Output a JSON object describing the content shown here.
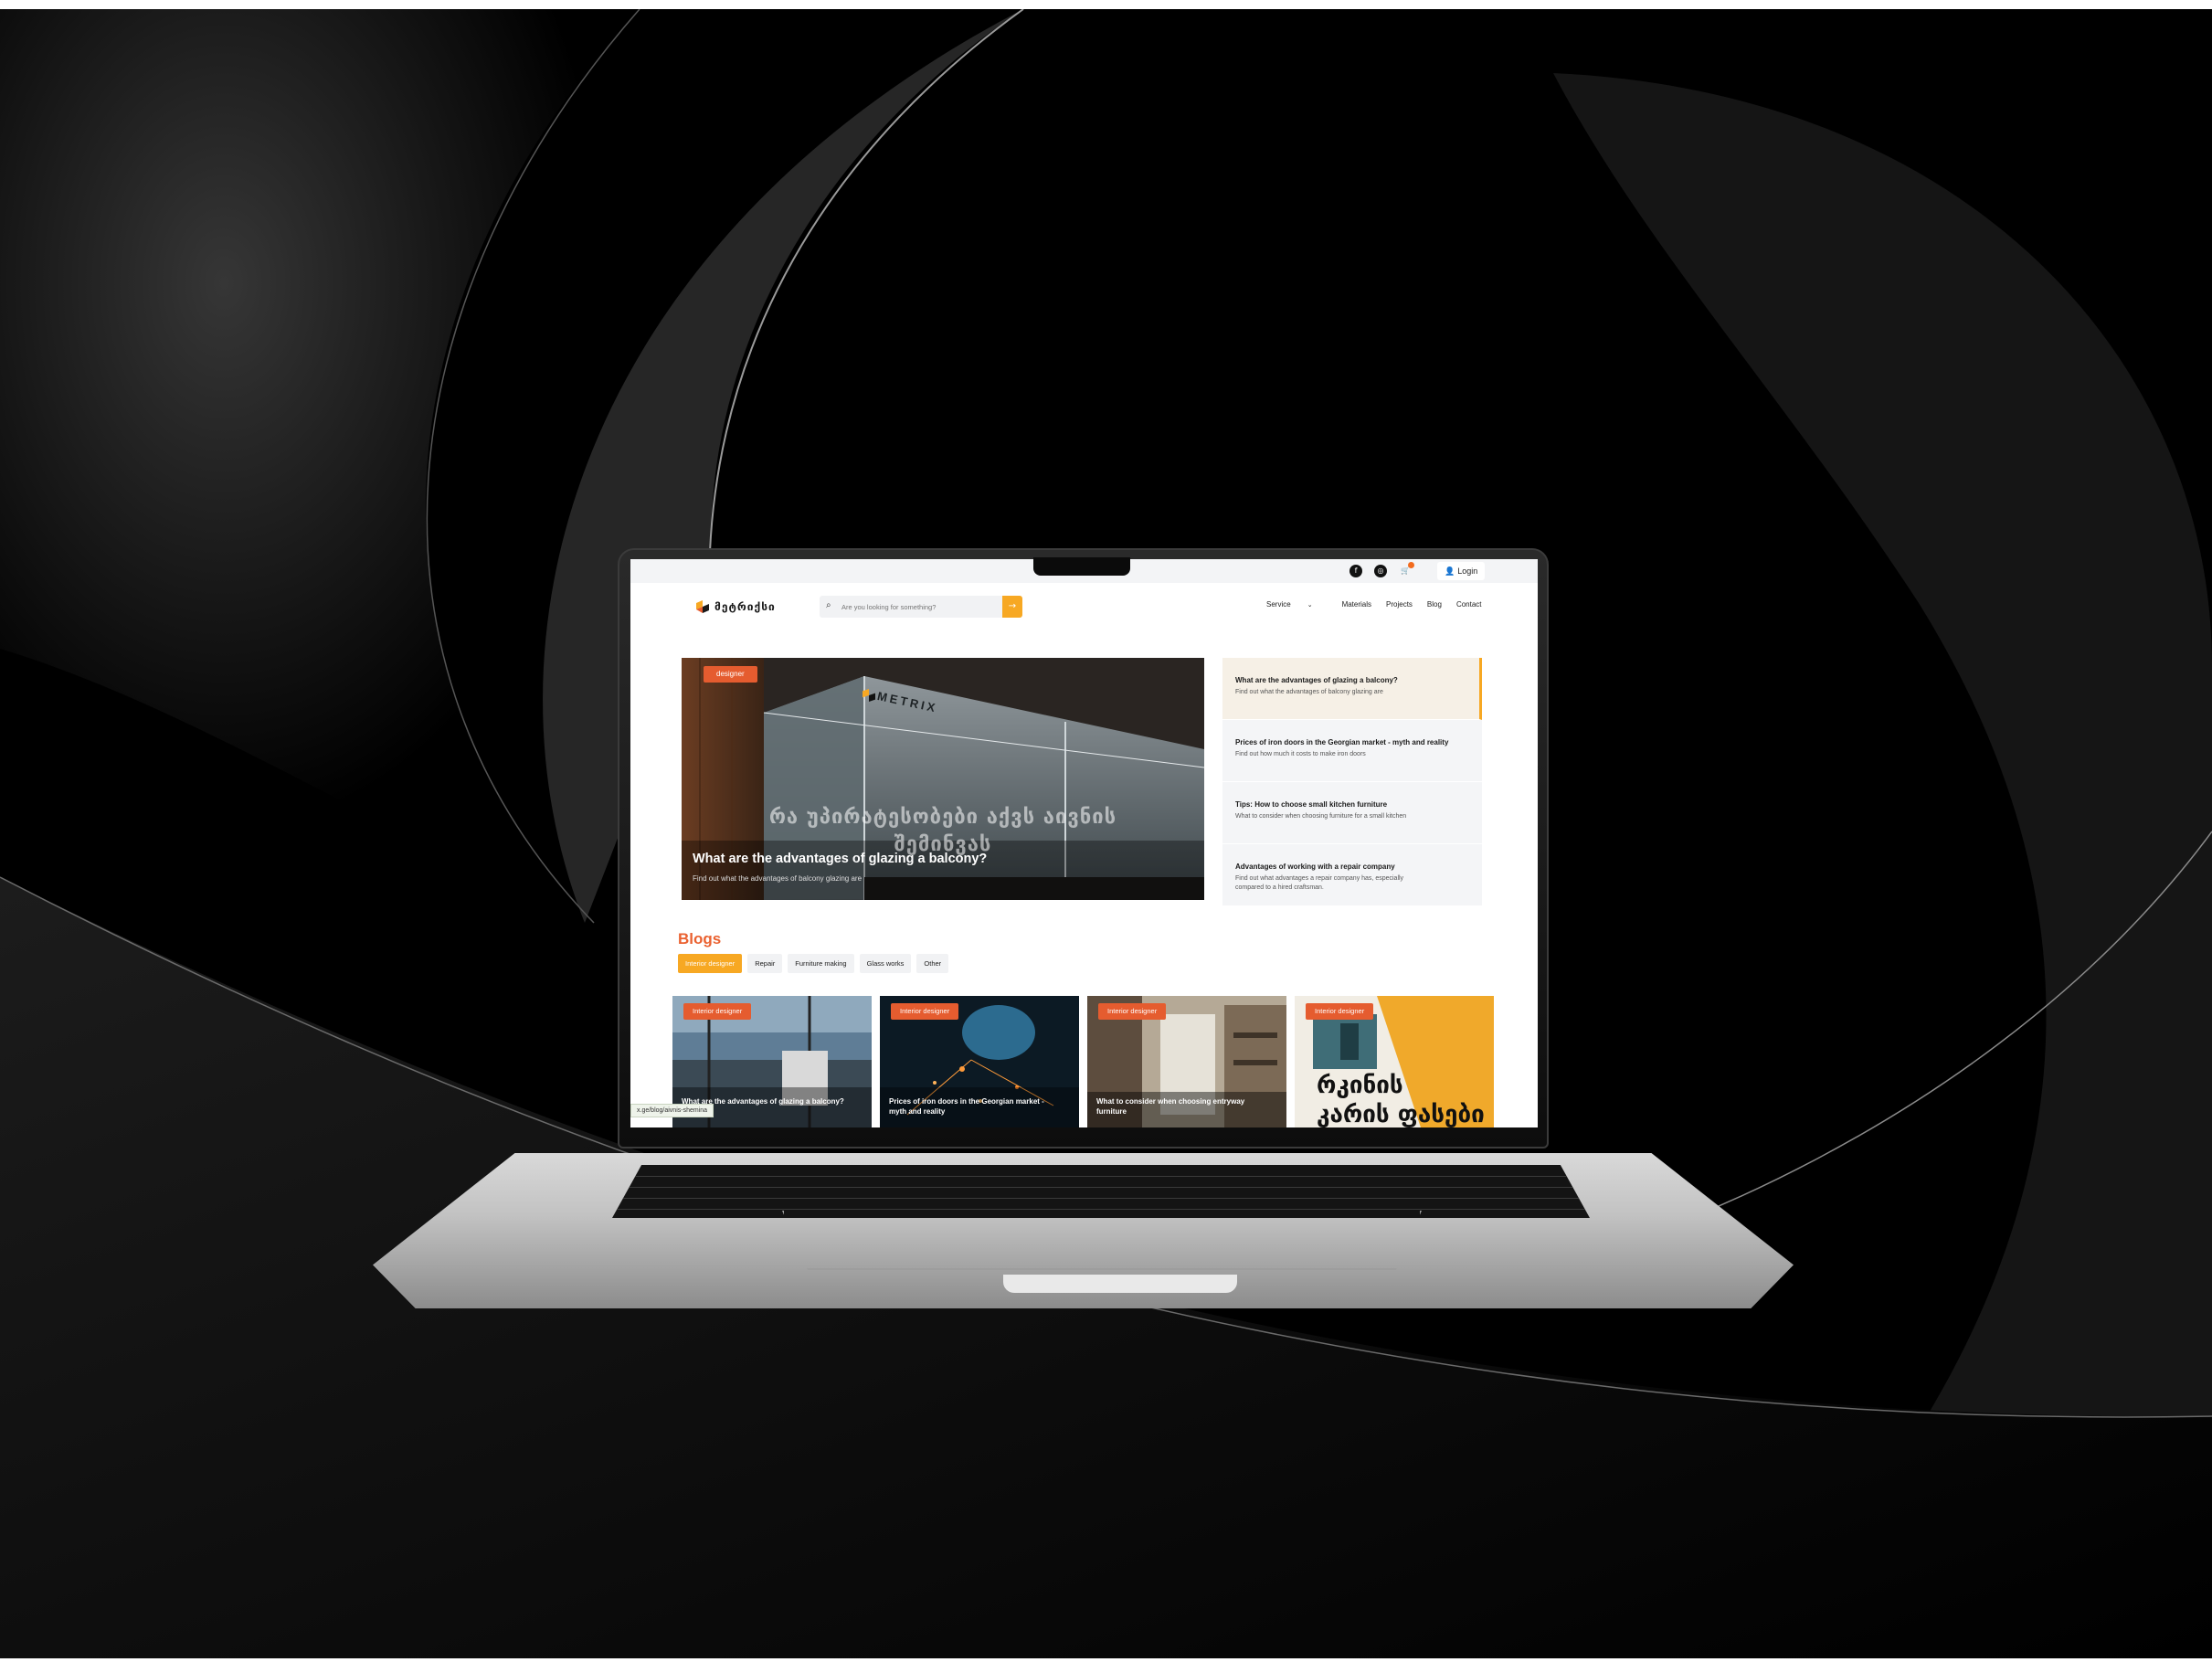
{
  "topbar": {
    "icons": [
      "facebook-icon",
      "instagram-icon",
      "cart-icon",
      "user-icon"
    ],
    "login_label": "Login"
  },
  "header": {
    "logo_text": "მეტრიქსი",
    "search_placeholder": "Are you looking for something?",
    "nav": [
      {
        "label": "Service",
        "has_caret": true
      },
      {
        "label": "Materials"
      },
      {
        "label": "Projects"
      },
      {
        "label": "Blog"
      },
      {
        "label": "Contact"
      }
    ]
  },
  "hero": {
    "tag": "designer",
    "sign_text": "METRIX",
    "ghost_text_line1": "რა უპირატესობები აქვს აივნის",
    "ghost_text_line2": "შემინვას",
    "title": "What are the advantages of glazing a balcony?",
    "subtitle": "Find out what the advantages of balcony glazing are"
  },
  "side_articles": [
    {
      "title": "What are the advantages of glazing a balcony?",
      "desc": "Find out what the advantages of balcony glazing are",
      "active": true
    },
    {
      "title": "Prices of iron doors in the Georgian market - myth and reality",
      "desc": "Find out how much it costs to make iron doors"
    },
    {
      "title": "Tips: How to choose small kitchen furniture",
      "desc": "What to consider when choosing furniture for a small kitchen"
    },
    {
      "title": "Advantages of working with a repair company",
      "desc": "Find out what advantages a repair company has, especially compared to a hired craftsman."
    }
  ],
  "blogs": {
    "title": "Blogs",
    "filters": [
      {
        "label": "Interior designer",
        "active": true
      },
      {
        "label": "Repair"
      },
      {
        "label": "Furniture making"
      },
      {
        "label": "Glass works"
      },
      {
        "label": "Other"
      }
    ],
    "cards": [
      {
        "tag": "Interior designer",
        "title": "What are the advantages of glazing a balcony?"
      },
      {
        "tag": "Interior designer",
        "title": "Prices of iron doors in the Georgian market - myth and reality"
      },
      {
        "tag": "Interior designer",
        "title": "What to consider when choosing entryway furniture"
      },
      {
        "tag": "Interior designer",
        "title": "რკინის კარის ფასები",
        "big_text_line1": "რკინის",
        "big_text_line2": "კარის ფასები"
      }
    ]
  },
  "status_url": "x.ge/blog/aivnis-shemina",
  "colors": {
    "accent": "#f7a823",
    "tag": "#e55c2f",
    "blogs_title": "#ea6130"
  }
}
